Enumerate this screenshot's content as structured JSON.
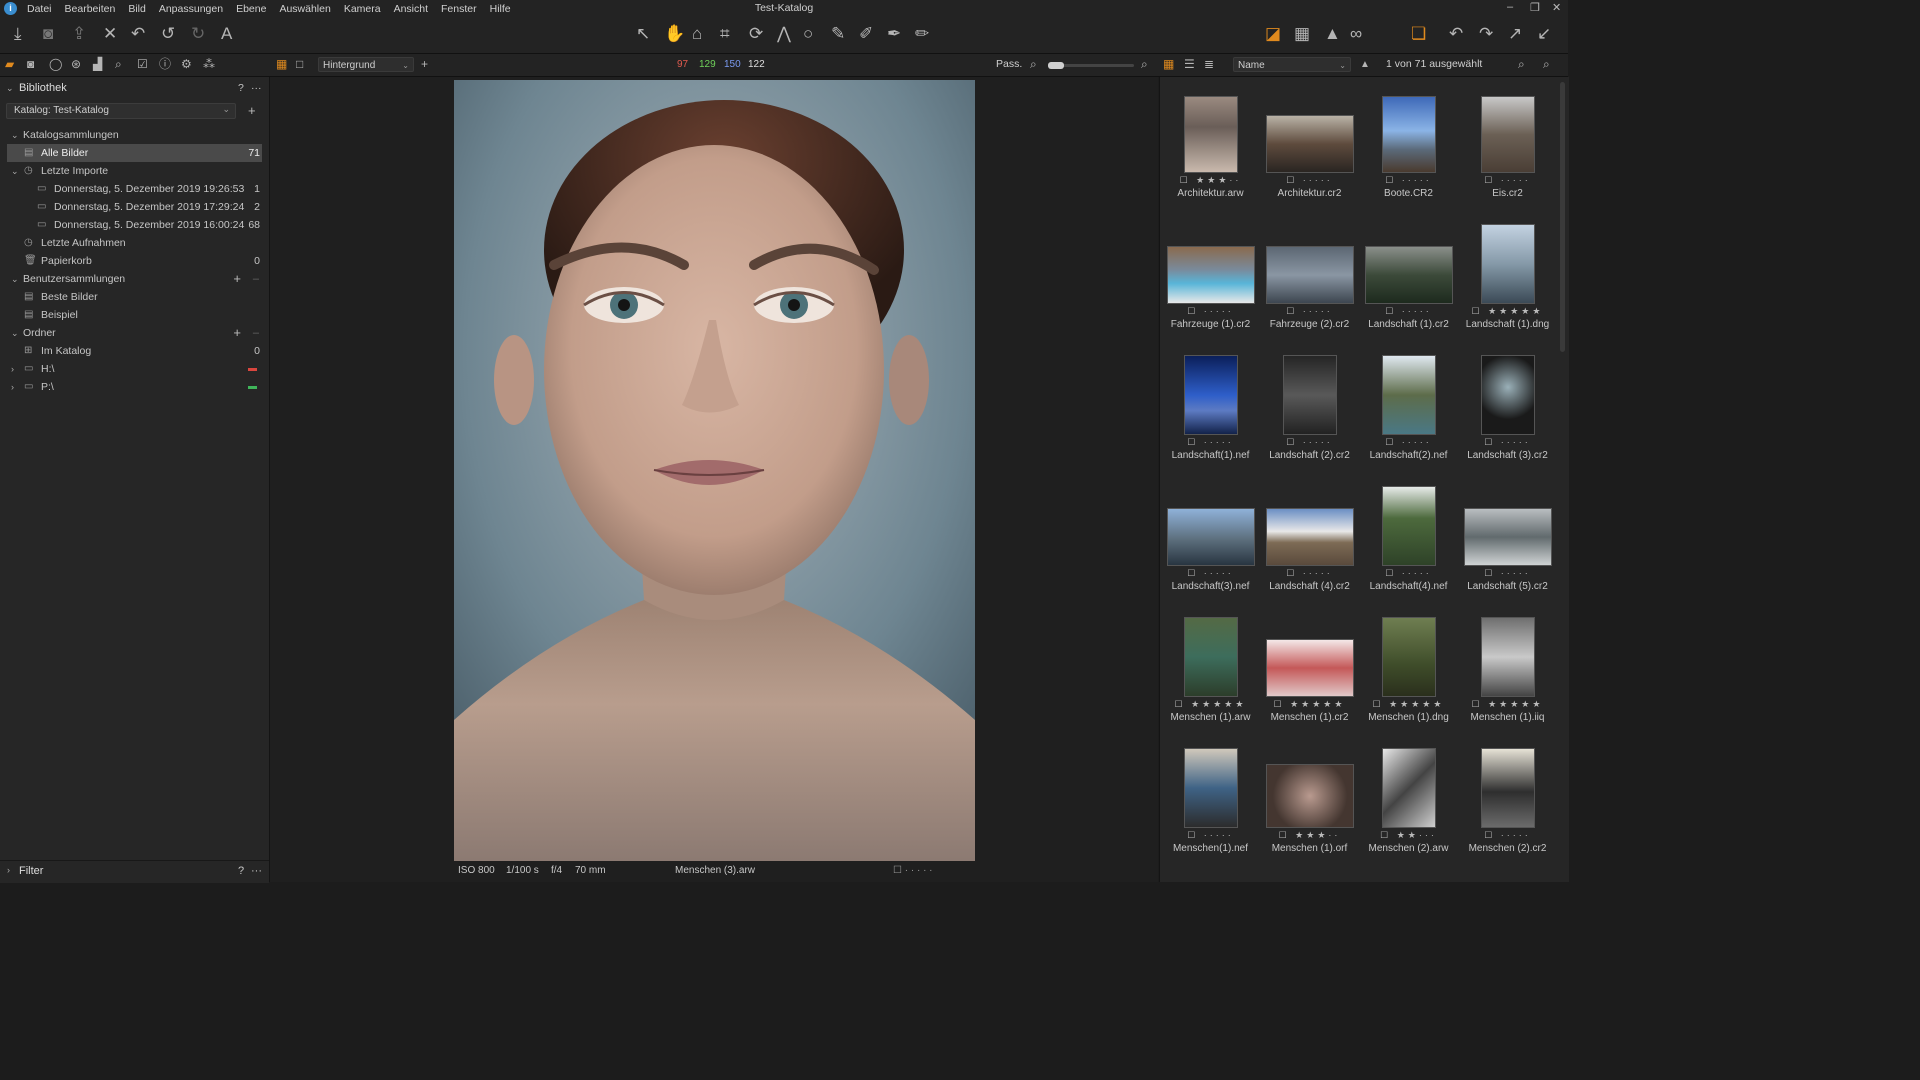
{
  "window": {
    "title": "Test-Katalog"
  },
  "menu": [
    "Datei",
    "Bearbeiten",
    "Bild",
    "Anpassungen",
    "Ebene",
    "Auswählen",
    "Kamera",
    "Ansicht",
    "Fenster",
    "Hilfe"
  ],
  "toolbar": {
    "left_icons": [
      "import-icon",
      "camera-icon",
      "export-icon",
      "delete-icon",
      "undo-history-icon",
      "undo-icon",
      "redo-icon",
      "text-icon"
    ],
    "center_icons": [
      "select-icon",
      "pan-icon",
      "pick-icon",
      "crop-icon",
      "rotate-icon",
      "keystone-icon",
      "circle-icon",
      "brush-icon",
      "eraser-icon",
      "pen-icon",
      "gradient-icon"
    ],
    "right_icons": [
      "exposure-warning-icon",
      "grid-icon",
      "warning-icon",
      "glasses-icon",
      "stack-icon",
      "rotate-left-icon",
      "rotate-right-icon",
      "expand-icon",
      "collapse-icon"
    ]
  },
  "subbar": {
    "layer_dropdown": "Hintergrund",
    "rgb": {
      "r": "97",
      "g": "129",
      "b": "150",
      "l": "122"
    },
    "fit_label": "Pass.",
    "sort_dropdown": "Name",
    "selection_status": "1 von 71 ausgewählt"
  },
  "library": {
    "title": "Bibliothek",
    "catalog_dropdown": "Katalog: Test-Katalog",
    "catalog_collections": "Katalogsammlungen",
    "all_images": {
      "label": "Alle Bilder",
      "count": "71"
    },
    "recent_imports": "Letzte Importe",
    "imports": [
      {
        "label": "Donnerstag, 5. Dezember 2019 19:26:53",
        "count": "1"
      },
      {
        "label": "Donnerstag, 5. Dezember 2019 17:29:24",
        "count": "2"
      },
      {
        "label": "Donnerstag, 5. Dezember 2019 16:00:24",
        "count": "68"
      }
    ],
    "recent_captures": "Letzte Aufnahmen",
    "trash": {
      "label": "Papierkorb",
      "count": "0"
    },
    "user_collections": "Benutzersammlungen",
    "user_items": [
      "Beste Bilder",
      "Beispiel"
    ],
    "folders": "Ordner",
    "in_catalog": {
      "label": "Im Katalog",
      "count": "0"
    },
    "drives": [
      {
        "label": "H:\\",
        "color": "#d9463e"
      },
      {
        "label": "P:\\",
        "color": "#3fb55a"
      }
    ],
    "filter": "Filter",
    "help": "?",
    "more": "···"
  },
  "viewer": {
    "iso": "ISO 800",
    "shutter": "1/100 s",
    "aperture": "f/4",
    "focal": "70 mm",
    "filename": "Menschen (3).arw"
  },
  "thumbnails": [
    {
      "name": "Architektur.arw",
      "stars": 3,
      "style": "arch1"
    },
    {
      "name": "Architektur.cr2",
      "stars": 0,
      "style": "arch2"
    },
    {
      "name": "Boote.CR2",
      "stars": 0,
      "style": "boats"
    },
    {
      "name": "Eis.cr2",
      "stars": 0,
      "style": "ice"
    },
    {
      "name": "Fahrzeuge (1).cr2",
      "stars": 0,
      "style": "car1"
    },
    {
      "name": "Fahrzeuge (2).cr2",
      "stars": 0,
      "style": "car2"
    },
    {
      "name": "Landschaft (1).cr2",
      "stars": 0,
      "style": "land1"
    },
    {
      "name": "Landschaft (1).dng",
      "stars": 5,
      "style": "land1d"
    },
    {
      "name": "Landschaft(1).nef",
      "stars": 0,
      "style": "land1n"
    },
    {
      "name": "Landschaft (2).cr2",
      "stars": 0,
      "style": "land2"
    },
    {
      "name": "Landschaft(2).nef",
      "stars": 0,
      "style": "land2n"
    },
    {
      "name": "Landschaft (3).cr2",
      "stars": 0,
      "style": "land3"
    },
    {
      "name": "Landschaft(3).nef",
      "stars": 0,
      "style": "land3n"
    },
    {
      "name": "Landschaft (4).cr2",
      "stars": 0,
      "style": "land4"
    },
    {
      "name": "Landschaft(4).nef",
      "stars": 0,
      "style": "land4n"
    },
    {
      "name": "Landschaft (5).cr2",
      "stars": 0,
      "style": "land5"
    },
    {
      "name": "Menschen (1).arw",
      "stars": 5,
      "style": "people1"
    },
    {
      "name": "Menschen (1).cr2",
      "stars": 5,
      "style": "people2"
    },
    {
      "name": "Menschen (1).dng",
      "stars": 5,
      "style": "people3"
    },
    {
      "name": "Menschen (1).iiq",
      "stars": 5,
      "style": "people4"
    },
    {
      "name": "Menschen(1).nef",
      "stars": 0,
      "style": "people5"
    },
    {
      "name": "Menschen (1).orf",
      "stars": 3,
      "style": "people6"
    },
    {
      "name": "Menschen (2).arw",
      "stars": 2,
      "style": "people7"
    },
    {
      "name": "Menschen (2).cr2",
      "stars": 0,
      "style": "people8"
    }
  ]
}
